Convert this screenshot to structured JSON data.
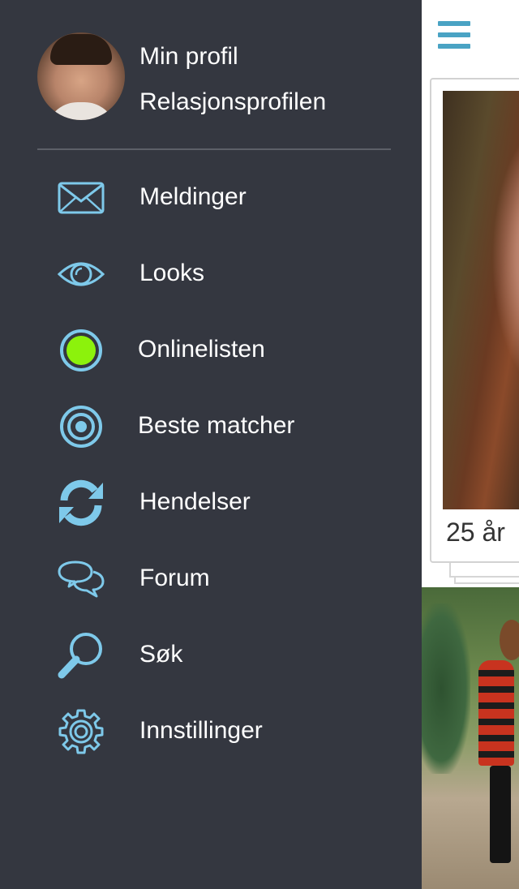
{
  "drawer": {
    "profile": {
      "my_profile": "Min profil",
      "relation_profile": "Relasjonsprofilen"
    },
    "menu": [
      {
        "label": "Meldinger",
        "icon": "envelope-icon"
      },
      {
        "label": "Looks",
        "icon": "eye-icon"
      },
      {
        "label": "Onlinelisten",
        "icon": "online-status-icon"
      },
      {
        "label": "Beste matcher",
        "icon": "target-icon"
      },
      {
        "label": "Hendelser",
        "icon": "refresh-icon"
      },
      {
        "label": "Forum",
        "icon": "chat-bubbles-icon"
      },
      {
        "label": "Søk",
        "icon": "search-icon"
      },
      {
        "label": "Innstillinger",
        "icon": "gear-icon"
      }
    ]
  },
  "content": {
    "card": {
      "age_label": "25 år"
    }
  },
  "colors": {
    "drawer_bg": "#343740",
    "icon_blue": "#7ec9ea",
    "online_green": "#8cf20c",
    "hamburger_blue": "#4aa3c4"
  }
}
